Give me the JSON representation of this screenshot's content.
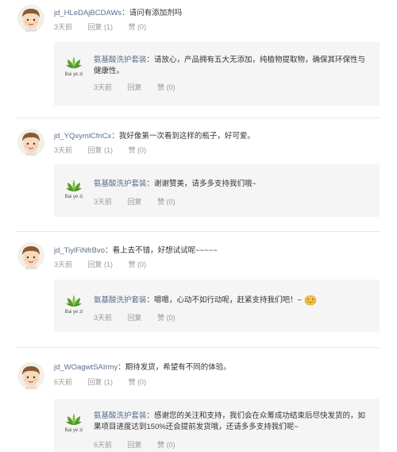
{
  "threads": [
    {
      "user": "jd_HLeDAjBCDAWs",
      "comment": "请问有添加剂吗",
      "time": "3天前",
      "reply_label": "回复 (1)",
      "like_label": "赞 (0)",
      "reply": {
        "brand": "氨基酸洗护套装",
        "text": "请放心，产品拥有五大无添加，纯植物提取物，确保其环保性与健康性。",
        "time": "3天前",
        "reply_label": "回复",
        "like_label": "赞 (0)"
      }
    },
    {
      "user": "jd_YQxymlCfriCx",
      "comment": "我好像第一次看到这样的瓶子，好可爱。",
      "time": "3天前",
      "reply_label": "回复 (1)",
      "like_label": "赞 (0)",
      "reply": {
        "brand": "氨基酸洗护套装",
        "text": "谢谢赞美，请多多支持我们哦~",
        "time": "3天前",
        "reply_label": "回复",
        "like_label": "赞 (0)"
      }
    },
    {
      "user": "jd_TiylFiNfrBvo",
      "comment": "看上去不错，好想试试呢~~~~~",
      "time": "3天前",
      "reply_label": "回复 (1)",
      "like_label": "赞 (0)",
      "reply": {
        "brand": "氨基酸洗护套装",
        "text": "嗯嗯，心动不如行动呢，赶紧支持我们吧！~",
        "time": "3天前",
        "reply_label": "回复",
        "like_label": "赞 (0)"
      }
    },
    {
      "user": "jd_WOagwtSAIrmy",
      "comment": "期待发货，希望有不同的体验。",
      "time": "6天前",
      "reply_label": "回复 (1)",
      "like_label": "赞 (0)",
      "reply": {
        "brand": "氨基酸洗护套装",
        "text": "感谢您的关注和支持，我们会在众筹成功结束后尽快发货的，如果项目进度达到150%还会提前发货哦，还请多多支持我们呢~",
        "time": "6天前",
        "reply_label": "回复",
        "like_label": "赞 (0)"
      }
    }
  ],
  "brand_logo_text": "Bai ye zi",
  "colors": {
    "username": "#5a6e8c",
    "meta": "#999999",
    "reply_bg": "#f5f5f5",
    "logo_green": "#5aa02c"
  }
}
